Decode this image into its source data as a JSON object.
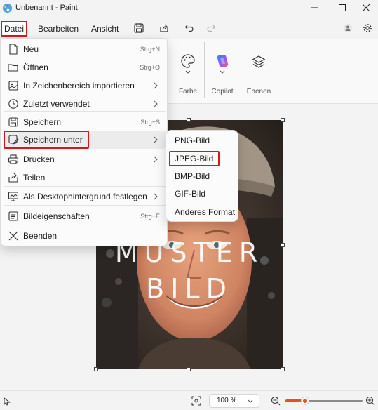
{
  "titlebar": {
    "title": "Unbenannt - Paint"
  },
  "menubar": {
    "datei": "Datei",
    "bearbeiten": "Bearbeiten",
    "ansicht": "Ansicht"
  },
  "ribbon": {
    "farbe": "Farbe",
    "copilot": "Copilot",
    "ebenen": "Ebenen"
  },
  "canvas": {
    "watermark_line1": "MUSTER",
    "watermark_line2": "BILD"
  },
  "file_menu": {
    "neu": {
      "label": "Neu",
      "shortcut": "Strg+N"
    },
    "oeffnen": {
      "label": "Öffnen",
      "shortcut": "Strg+O"
    },
    "importieren": {
      "label": "In Zeichenbereich importieren"
    },
    "zuletzt": {
      "label": "Zuletzt verwendet"
    },
    "speichern": {
      "label": "Speichern",
      "shortcut": "Strg+S"
    },
    "speichern_unter": {
      "label": "Speichern unter"
    },
    "drucken": {
      "label": "Drucken"
    },
    "teilen": {
      "label": "Teilen"
    },
    "desktop": {
      "label": "Als Desktophintergrund festlegen"
    },
    "eigenschaften": {
      "label": "Bildeigenschaften",
      "shortcut": "Strg+E"
    },
    "beenden": {
      "label": "Beenden"
    }
  },
  "save_as_submenu": {
    "png": "PNG-Bild",
    "jpeg": "JPEG-Bild",
    "bmp": "BMP-Bild",
    "gif": "GIF-Bild",
    "other": "Anderes Format"
  },
  "statusbar": {
    "zoom": "100 %",
    "zoom_level": 0.25
  },
  "colors": {
    "highlight_red": "#d9161d",
    "slider_accent": "#e8511a"
  }
}
